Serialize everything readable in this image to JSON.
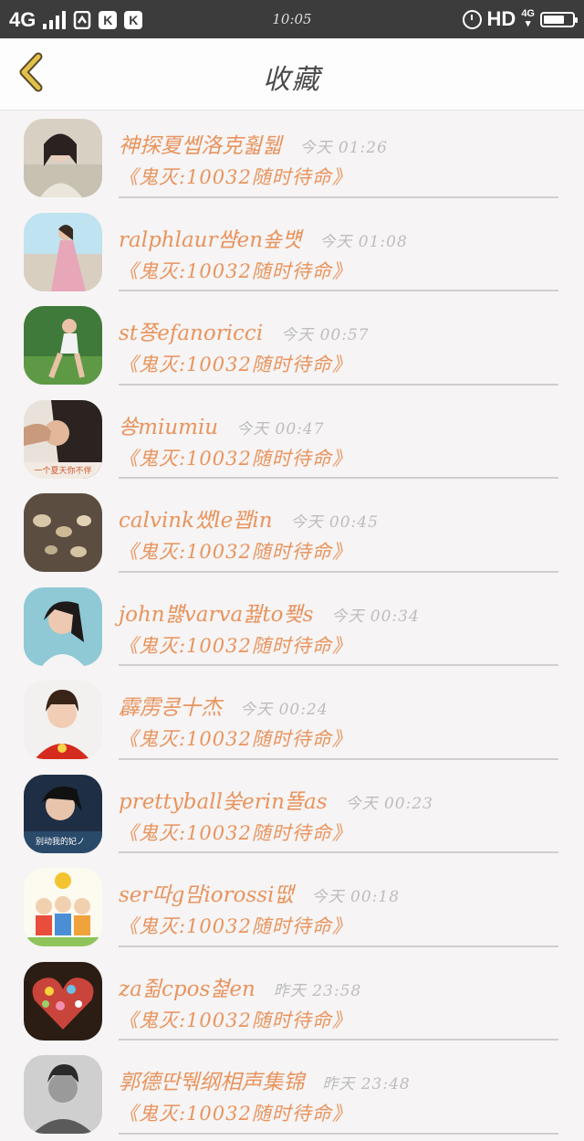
{
  "status_bar": {
    "network": "4G",
    "time": "10:05",
    "hd": "HD",
    "net_type": "4G",
    "app_badges": [
      "K",
      "K"
    ]
  },
  "header": {
    "title": "收藏"
  },
  "messages": [
    {
      "name": "神探夏쎕洛克훫뒓",
      "time": "今天 01:26",
      "preview": "《鬼灭:10032随时待命》"
    },
    {
      "name": "ralphlaur썀en숖뱻",
      "time": "今天 01:08",
      "preview": "《鬼灭:10032随时待命》"
    },
    {
      "name": "st쭁efanoricci",
      "time": "今天 00:57",
      "preview": "《鬼灭:10032随时待命》"
    },
    {
      "name": "쑝miumiu",
      "time": "今天 00:47",
      "preview": "《鬼灭:10032随时待命》"
    },
    {
      "name": "calvink쌨le꽵in",
      "time": "今天 00:45",
      "preview": "《鬼灭:10032随时待命》"
    },
    {
      "name": "john뱷varva꿢to퐺s",
      "time": "今天 00:34",
      "preview": "《鬼灭:10032随时待命》"
    },
    {
      "name": "霹雳콩十杰",
      "time": "今天 00:24",
      "preview": "《鬼灭:10032随时待命》"
    },
    {
      "name": "prettyball쑺erin뚈as",
      "time": "今天 00:23",
      "preview": "《鬼灭:10032随时待命》"
    },
    {
      "name": "ser따g맘iorossi땞",
      "time": "今天 00:18",
      "preview": "《鬼灭:10032随时待命》"
    },
    {
      "name": "za쥚cpos쳝en",
      "time": "昨天 23:58",
      "preview": "《鬼灭:10032随时待命》"
    },
    {
      "name": "郭德딴뛖纲相声集锦",
      "time": "昨天 23:48",
      "preview": "《鬼灭:10032随时待命》"
    }
  ],
  "avatar_texts": {
    "item4": "一个夏天你不伴",
    "item8": "别动我的妃ノ"
  },
  "colors": {
    "accent": "#e8945e",
    "time_gray": "#bdbdbd",
    "back_arrow": "#e2c14a"
  }
}
